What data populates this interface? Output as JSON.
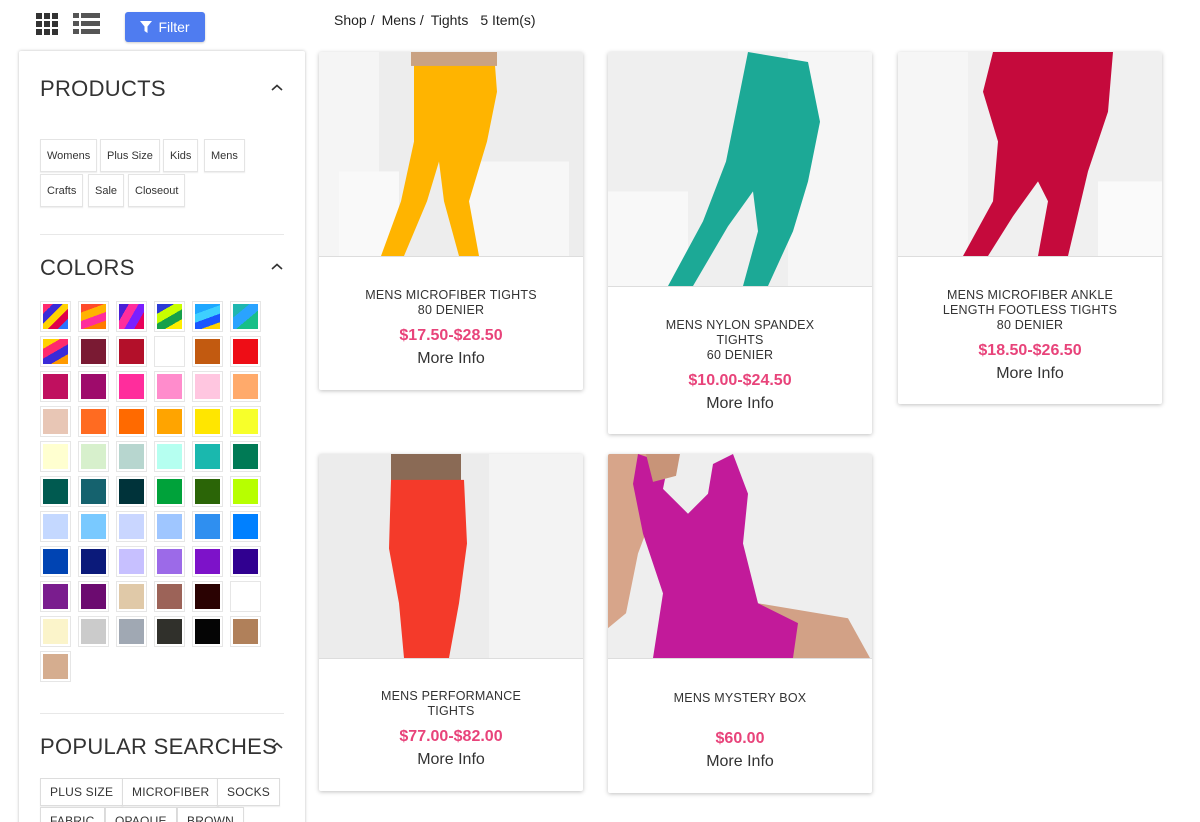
{
  "toolbar": {
    "filter_label": "Filter"
  },
  "breadcrumb": {
    "items": [
      "Shop",
      "Mens",
      "Tights"
    ],
    "count": "5 Item(s)"
  },
  "sidebar": {
    "products": {
      "title": "PRODUCTS",
      "tags": [
        "Womens",
        "Plus Size",
        "Kids",
        "Mens",
        "Crafts",
        "Sale",
        "Closeout"
      ]
    },
    "colors": {
      "title": "COLORS",
      "swatches": [
        "pattern-rainbow-1",
        "pattern-rainbow-2",
        "pattern-rainbow-3",
        "pattern-rainbow-4",
        "pattern-rainbow-5",
        "pattern-rainbow-6",
        "pattern-rainbow-7",
        "#7a1a33",
        "#b3102a",
        "#ffffff",
        "#c25a10",
        "#ee0d16",
        "#c0105f",
        "#9e0b6b",
        "#ff2d9c",
        "#ff8ccc",
        "#ffc6e0",
        "#ffaa6b",
        "#e8c6b5",
        "#ff6b21",
        "#ff6a00",
        "#ffa400",
        "#ffe600",
        "#f7ff2a",
        "#ffffd0",
        "#d7f0cc",
        "#b7d6cf",
        "#b5fff0",
        "#1ab8ae",
        "#007a55",
        "#005a50",
        "#15626e",
        "#00333a",
        "#00a23a",
        "#2b6507",
        "#b7ff00",
        "#c4d8ff",
        "#79c9ff",
        "#c9d6ff",
        "#9fc6ff",
        "#2f8ff0",
        "#0080ff",
        "#0044b3",
        "#0b1a7a",
        "#c7c0ff",
        "#9c6ae8",
        "#7d12c9",
        "#300090",
        "#7a1d8e",
        "#6c0b70",
        "#e0c9a8",
        "#9c6358",
        "#2a0202",
        "#ffffff",
        "#fbf4ca",
        "#cbcbcb",
        "#a0a8b3",
        "#30302b",
        "#050505",
        "#b0805a",
        "#d5ad8f"
      ]
    },
    "popular": {
      "title": "POPULAR SEARCHES",
      "tags": [
        "PLUS SIZE",
        "MICROFIBER",
        "SOCKS",
        "FABRIC",
        "OPAQUE",
        "BROWN"
      ]
    }
  },
  "products": [
    {
      "name_lines": [
        "MENS MICROFIBER TIGHTS",
        "80 DENIER"
      ],
      "price": "$17.50-$28.50",
      "more": "More Info",
      "image_color": "#ffb400"
    },
    {
      "name_lines": [
        "MENS NYLON SPANDEX",
        "TIGHTS",
        "60 DENIER"
      ],
      "price": "$10.00-$24.50",
      "more": "More Info",
      "image_color": "#1ca996"
    },
    {
      "name_lines": [
        "MENS MICROFIBER ANKLE",
        "LENGTH FOOTLESS TIGHTS",
        "80 DENIER"
      ],
      "price": "$18.50-$26.50",
      "more": "More Info",
      "image_color": "#c50a3c"
    },
    {
      "name_lines": [
        "MENS PERFORMANCE",
        "TIGHTS"
      ],
      "price": "$77.00-$82.00",
      "more": "More Info",
      "image_color": "#f43a2a"
    },
    {
      "name_lines": [
        "MENS MYSTERY BOX"
      ],
      "price": "$60.00",
      "more": "More Info",
      "image_color": "#c21a9a"
    }
  ],
  "colors": {
    "accent": "#4f7cf0",
    "price": "#e8437a"
  }
}
